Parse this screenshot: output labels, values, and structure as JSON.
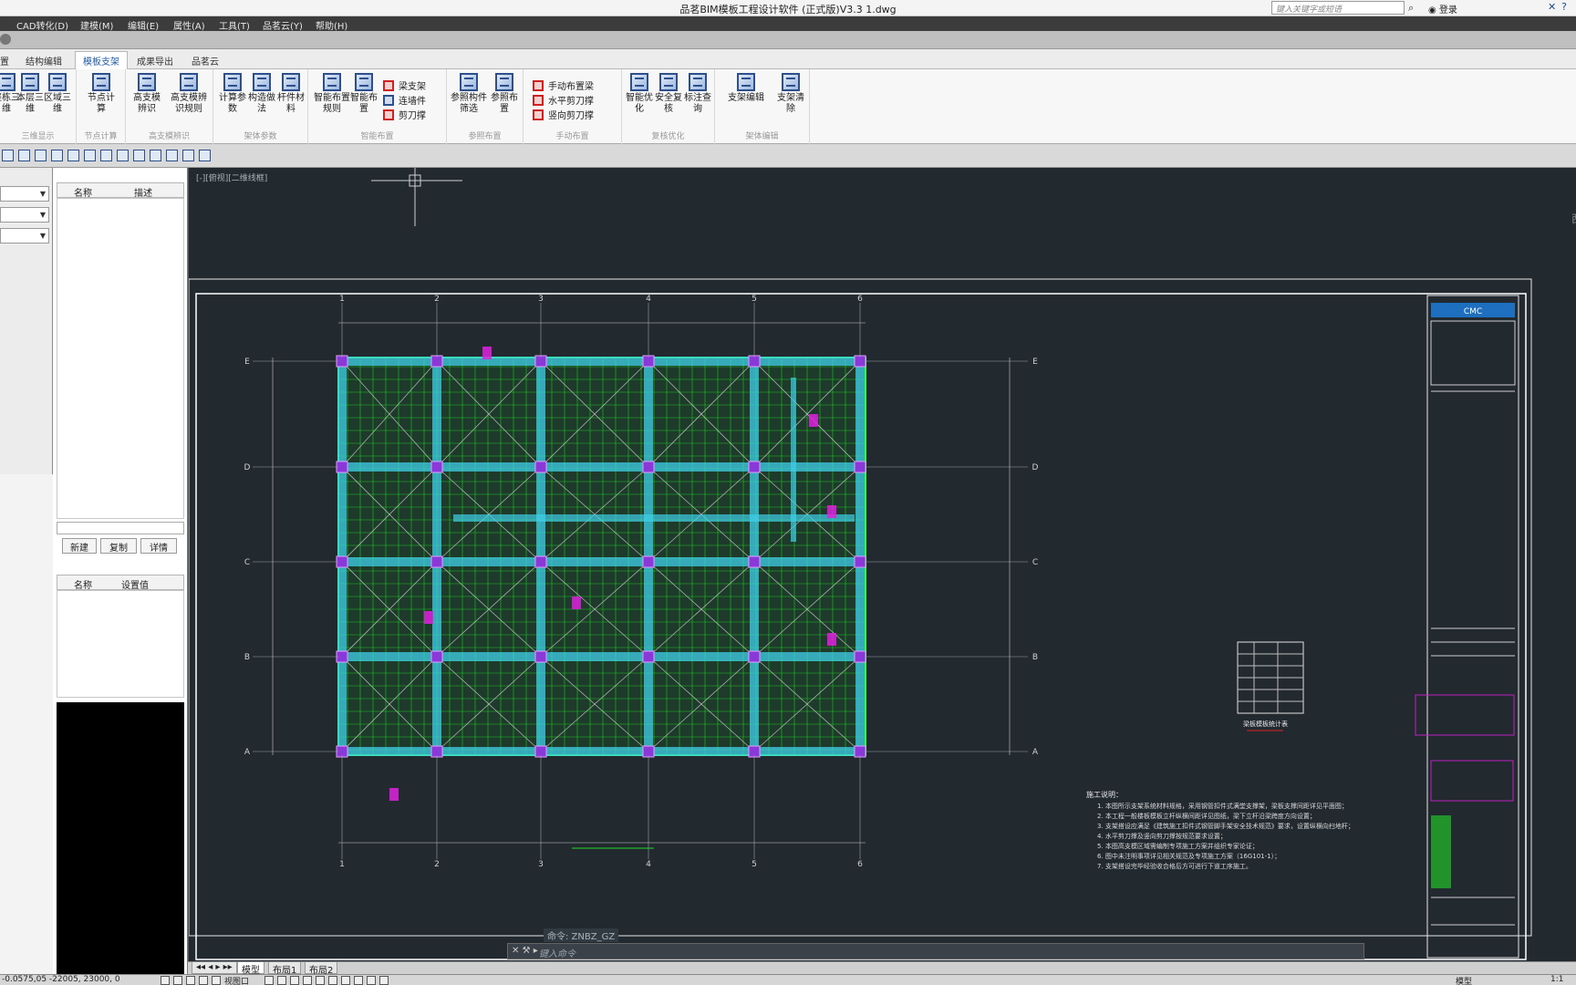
{
  "window": {
    "title": "品茗BIM模板工程设计软件 (正式版)V3.3    1.dwg",
    "search_placeholder": "键入关键字或短语",
    "login_label": "登录"
  },
  "menu": [
    {
      "label": "CAD转化(D)"
    },
    {
      "label": "建模(M)"
    },
    {
      "label": "编辑(E)"
    },
    {
      "label": "属性(A)"
    },
    {
      "label": "工具(T)"
    },
    {
      "label": "品茗云(Y)"
    },
    {
      "label": "帮助(H)"
    }
  ],
  "ribbon_tabs": [
    {
      "label": "置"
    },
    {
      "label": "结构编辑"
    },
    {
      "label": "模板支架",
      "active": true
    },
    {
      "label": "成果导出"
    },
    {
      "label": "品茗云"
    }
  ],
  "ribbon_groups": [
    {
      "label": "三维显示",
      "buttons": [
        "整栋三维",
        "本层三维",
        "区域三维"
      ]
    },
    {
      "label": "节点计算",
      "buttons": [
        "节点计算"
      ]
    },
    {
      "label": "高支模辨识",
      "buttons": [
        "高支模辨识",
        "高支模辨识规则"
      ]
    },
    {
      "label": "架体参数",
      "buttons": [
        "计算参数",
        "构造做法",
        "杆件材料"
      ]
    },
    {
      "label": "智能布置",
      "buttons": [
        "智能布置规则",
        "智能布置"
      ],
      "small": [
        "梁支架",
        "连墙件",
        "剪刀撑"
      ]
    },
    {
      "label": "参照布置",
      "buttons": [
        "参照构件筛选",
        "参照布置"
      ]
    },
    {
      "label": "手动布置",
      "small": [
        "手动布置梁",
        "水平剪刀撑",
        "竖向剪刀撑"
      ]
    },
    {
      "label": "复核优化",
      "buttons": [
        "智能优化",
        "安全复核",
        "标注查询"
      ]
    },
    {
      "label": "架体编辑",
      "buttons": [
        "支架编辑",
        "支架清除"
      ]
    }
  ],
  "mid_panel": {
    "grid1_headers": [
      "名称",
      "描述"
    ],
    "buttons": [
      "新建",
      "复制",
      "详情"
    ],
    "grid2_headers": [
      "名称",
      "设置值"
    ]
  },
  "drawing": {
    "view_label": "[-][俯视][二维线框]",
    "grid_cols": [
      "1",
      "2",
      "3",
      "4",
      "5",
      "6"
    ],
    "grid_rows": [
      "E",
      "D",
      "C",
      "B",
      "A"
    ],
    "right_rows": [
      "E",
      "D",
      "C",
      "B",
      "A"
    ],
    "notes_title": "施工说明：",
    "notes": [
      "1. 本图所示支架系统材料规格，采用钢管扣件式满堂支撑架，梁板支撑间距详见平面图；",
      "2. 本工程一般楼板模板立杆纵横间距详见图纸，梁下立杆沿梁跨度方向设置；",
      "3. 支架搭设应满足《建筑施工扣件式钢管脚手架安全技术规范》要求，设置纵横向扫地杆；",
      "4. 水平剪刀撑及竖向剪刀撑按规范要求设置；",
      "5. 本图高支模区域需编制专项施工方案并组织专家论证；",
      "6. 图中未注明事项详见相关规范及专项施工方案（16G101-1）；",
      "7. 支架搭设完毕经验收合格后方可进行下道工序施工。"
    ],
    "legend_title": "梁板模板统计表",
    "titleblock_logo": "CMC"
  },
  "bottom": {
    "tabs": [
      "模型",
      "布局1",
      "布局2"
    ],
    "cmd_history": "命令: ZNBZ_GZ",
    "cmd_placeholder": "键入命令"
  },
  "status": {
    "coord": "-0.0575,05   -22005, 23000, 0",
    "viewport": "视图口",
    "model_label": "模型",
    "scale": "1:1"
  }
}
